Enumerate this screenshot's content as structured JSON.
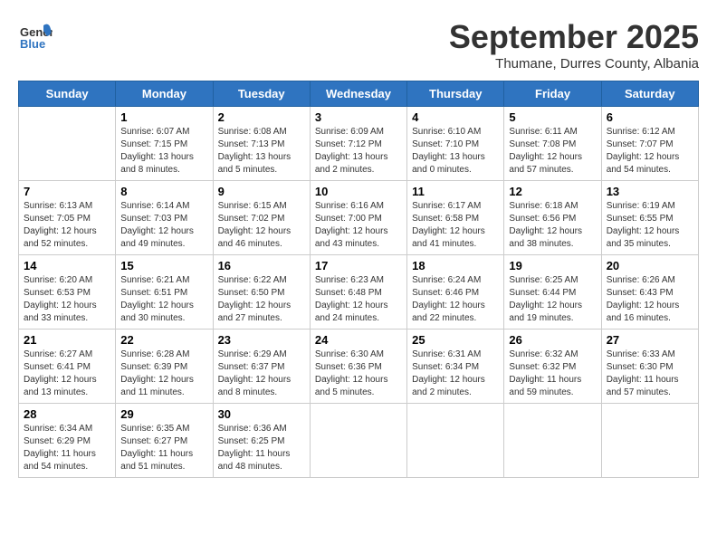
{
  "header": {
    "logo_general": "General",
    "logo_blue": "Blue",
    "month_title": "September 2025",
    "location": "Thumane, Durres County, Albania"
  },
  "weekdays": [
    "Sunday",
    "Monday",
    "Tuesday",
    "Wednesday",
    "Thursday",
    "Friday",
    "Saturday"
  ],
  "weeks": [
    [
      {
        "day": "",
        "info": ""
      },
      {
        "day": "1",
        "info": "Sunrise: 6:07 AM\nSunset: 7:15 PM\nDaylight: 13 hours\nand 8 minutes."
      },
      {
        "day": "2",
        "info": "Sunrise: 6:08 AM\nSunset: 7:13 PM\nDaylight: 13 hours\nand 5 minutes."
      },
      {
        "day": "3",
        "info": "Sunrise: 6:09 AM\nSunset: 7:12 PM\nDaylight: 13 hours\nand 2 minutes."
      },
      {
        "day": "4",
        "info": "Sunrise: 6:10 AM\nSunset: 7:10 PM\nDaylight: 13 hours\nand 0 minutes."
      },
      {
        "day": "5",
        "info": "Sunrise: 6:11 AM\nSunset: 7:08 PM\nDaylight: 12 hours\nand 57 minutes."
      },
      {
        "day": "6",
        "info": "Sunrise: 6:12 AM\nSunset: 7:07 PM\nDaylight: 12 hours\nand 54 minutes."
      }
    ],
    [
      {
        "day": "7",
        "info": "Sunrise: 6:13 AM\nSunset: 7:05 PM\nDaylight: 12 hours\nand 52 minutes."
      },
      {
        "day": "8",
        "info": "Sunrise: 6:14 AM\nSunset: 7:03 PM\nDaylight: 12 hours\nand 49 minutes."
      },
      {
        "day": "9",
        "info": "Sunrise: 6:15 AM\nSunset: 7:02 PM\nDaylight: 12 hours\nand 46 minutes."
      },
      {
        "day": "10",
        "info": "Sunrise: 6:16 AM\nSunset: 7:00 PM\nDaylight: 12 hours\nand 43 minutes."
      },
      {
        "day": "11",
        "info": "Sunrise: 6:17 AM\nSunset: 6:58 PM\nDaylight: 12 hours\nand 41 minutes."
      },
      {
        "day": "12",
        "info": "Sunrise: 6:18 AM\nSunset: 6:56 PM\nDaylight: 12 hours\nand 38 minutes."
      },
      {
        "day": "13",
        "info": "Sunrise: 6:19 AM\nSunset: 6:55 PM\nDaylight: 12 hours\nand 35 minutes."
      }
    ],
    [
      {
        "day": "14",
        "info": "Sunrise: 6:20 AM\nSunset: 6:53 PM\nDaylight: 12 hours\nand 33 minutes."
      },
      {
        "day": "15",
        "info": "Sunrise: 6:21 AM\nSunset: 6:51 PM\nDaylight: 12 hours\nand 30 minutes."
      },
      {
        "day": "16",
        "info": "Sunrise: 6:22 AM\nSunset: 6:50 PM\nDaylight: 12 hours\nand 27 minutes."
      },
      {
        "day": "17",
        "info": "Sunrise: 6:23 AM\nSunset: 6:48 PM\nDaylight: 12 hours\nand 24 minutes."
      },
      {
        "day": "18",
        "info": "Sunrise: 6:24 AM\nSunset: 6:46 PM\nDaylight: 12 hours\nand 22 minutes."
      },
      {
        "day": "19",
        "info": "Sunrise: 6:25 AM\nSunset: 6:44 PM\nDaylight: 12 hours\nand 19 minutes."
      },
      {
        "day": "20",
        "info": "Sunrise: 6:26 AM\nSunset: 6:43 PM\nDaylight: 12 hours\nand 16 minutes."
      }
    ],
    [
      {
        "day": "21",
        "info": "Sunrise: 6:27 AM\nSunset: 6:41 PM\nDaylight: 12 hours\nand 13 minutes."
      },
      {
        "day": "22",
        "info": "Sunrise: 6:28 AM\nSunset: 6:39 PM\nDaylight: 12 hours\nand 11 minutes."
      },
      {
        "day": "23",
        "info": "Sunrise: 6:29 AM\nSunset: 6:37 PM\nDaylight: 12 hours\nand 8 minutes."
      },
      {
        "day": "24",
        "info": "Sunrise: 6:30 AM\nSunset: 6:36 PM\nDaylight: 12 hours\nand 5 minutes."
      },
      {
        "day": "25",
        "info": "Sunrise: 6:31 AM\nSunset: 6:34 PM\nDaylight: 12 hours\nand 2 minutes."
      },
      {
        "day": "26",
        "info": "Sunrise: 6:32 AM\nSunset: 6:32 PM\nDaylight: 11 hours\nand 59 minutes."
      },
      {
        "day": "27",
        "info": "Sunrise: 6:33 AM\nSunset: 6:30 PM\nDaylight: 11 hours\nand 57 minutes."
      }
    ],
    [
      {
        "day": "28",
        "info": "Sunrise: 6:34 AM\nSunset: 6:29 PM\nDaylight: 11 hours\nand 54 minutes."
      },
      {
        "day": "29",
        "info": "Sunrise: 6:35 AM\nSunset: 6:27 PM\nDaylight: 11 hours\nand 51 minutes."
      },
      {
        "day": "30",
        "info": "Sunrise: 6:36 AM\nSunset: 6:25 PM\nDaylight: 11 hours\nand 48 minutes."
      },
      {
        "day": "",
        "info": ""
      },
      {
        "day": "",
        "info": ""
      },
      {
        "day": "",
        "info": ""
      },
      {
        "day": "",
        "info": ""
      }
    ]
  ]
}
